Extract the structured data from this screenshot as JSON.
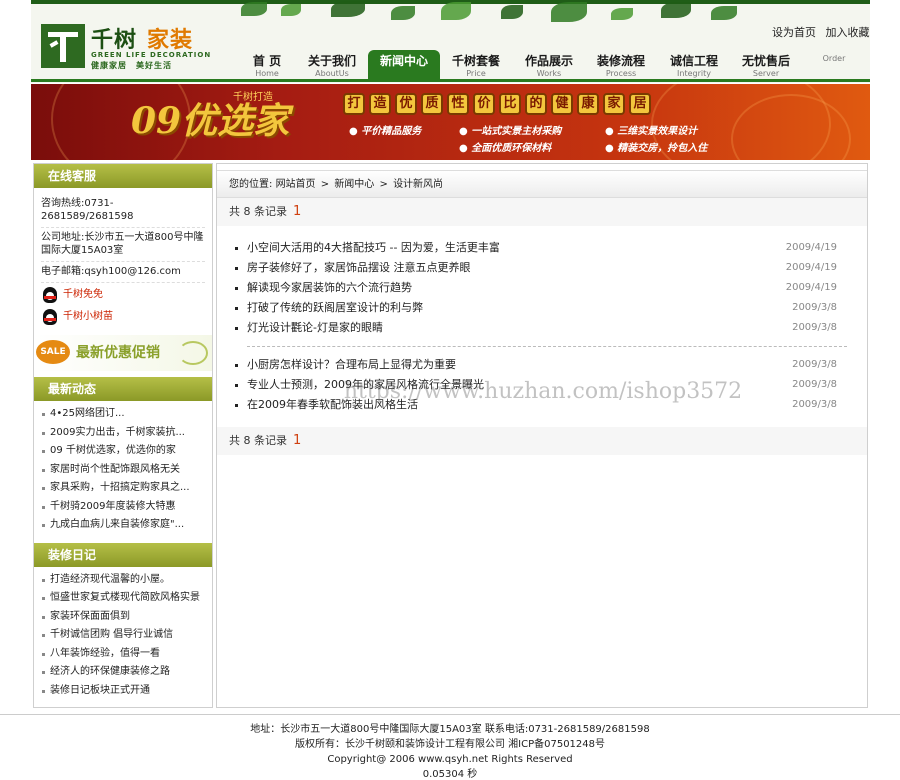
{
  "header": {
    "logo_cn_1": "千树",
    "logo_cn_2": "家装",
    "logo_en": "GREEN LIFE DECORATION",
    "logo_slogan": "健康家居　美好生活",
    "toplinks": {
      "homepage": "设为首页",
      "favorite": "加入收藏"
    }
  },
  "nav": [
    {
      "cn": "首 页",
      "en": "Home"
    },
    {
      "cn": "关于我们",
      "en": "AboutUs"
    },
    {
      "cn": "新闻中心",
      "en": ""
    },
    {
      "cn": "千树套餐",
      "en": "Price"
    },
    {
      "cn": "作品展示",
      "en": "Works"
    },
    {
      "cn": "装修流程",
      "en": "Process"
    },
    {
      "cn": "诚信工程",
      "en": "Integrity"
    },
    {
      "cn": "无忧售后",
      "en": "Server"
    },
    {
      "cn": "",
      "en": "Order"
    }
  ],
  "banner": {
    "small": "千树打造",
    "big": "09优选家",
    "slogan_chars": [
      "打",
      "造",
      "优",
      "质",
      "性",
      "价",
      "比",
      "的",
      "健",
      "康",
      "家",
      "居"
    ],
    "features": [
      "平价精品服务",
      "一站式实景主材采购",
      "三维实景效果设计",
      "全面优质环保材料",
      "精装交房，拎包入住"
    ]
  },
  "sidebar": {
    "kefu_title": "在线客服",
    "hotline": "咨询热线:0731-2681589/2681598",
    "address": "公司地址:长沙市五一大道800号中隆国际大厦15A03室",
    "email": "电子邮箱:qsyh100@126.com",
    "qq": [
      "千树免免",
      "千树小树苗"
    ],
    "promo_sale": "SALE",
    "promo_text": "最新优惠促销",
    "news_title": "最新动态",
    "news": [
      "4•25网络团订...",
      "2009实力出击，千树家装抗...",
      "09 千树优选家，优选你的家",
      "家居时尚个性配饰跟风格无关",
      "家具采购，十招搞定购家具之...",
      "千树骑2009年度装修大特惠",
      "九成白血病儿来自装修家庭\"..."
    ],
    "diary_title": "装修日记",
    "diary": [
      "打造经济现代温馨的小屋。",
      "恒盛世家复式楼现代简欧风格实景",
      "家装环保面面俱到",
      "千树诚信团购 倡导行业诚信",
      "八年装饰经验，值得一看",
      "经济人的环保健康装修之路",
      "装修日记板块正式开通"
    ]
  },
  "main": {
    "breadcrumb": {
      "prefix": "您的位置:",
      "home": "网站首页",
      "center": "新闻中心",
      "current": "设计新风尚"
    },
    "count_text": "共 8 条记录",
    "count_num": "1",
    "group1": [
      {
        "title": "小空间大活用的4大搭配技巧 -- 因为爱，生活更丰富",
        "date": "2009/4/19"
      },
      {
        "title": "房子装修好了，家居饰品摆设 注意五点更养眼",
        "date": "2009/4/19"
      },
      {
        "title": "解读现今家居装饰的六个流行趋势",
        "date": "2009/4/19"
      },
      {
        "title": "打破了传统的跃阁居室设计的利与弊",
        "date": "2009/3/8"
      },
      {
        "title": "灯光设计氍论-灯是家的眼睛",
        "date": "2009/3/8"
      }
    ],
    "group2": [
      {
        "title": "小厨房怎样设计？合理布局上显得尤为重要",
        "date": "2009/3/8"
      },
      {
        "title": "专业人士预测，2009年的家居风格流行全景曝光",
        "date": "2009/3/8"
      },
      {
        "title": "在2009年春季软配饰装出风格生活",
        "date": "2009/3/8"
      }
    ],
    "watermark": "https://www.huzhan.com/ishop3572"
  },
  "footer": {
    "line1": "地址：长沙市五一大道800号中隆国际大厦15A03室 联系电话:0731-2681589/2681598",
    "line2": "版权所有：长沙千树颐和装饰设计工程有限公司 湘ICP备07501248号",
    "line3": "Copyright@ 2006 www.qsyh.net Rights Reserved",
    "line4": "0.05304 秒"
  }
}
